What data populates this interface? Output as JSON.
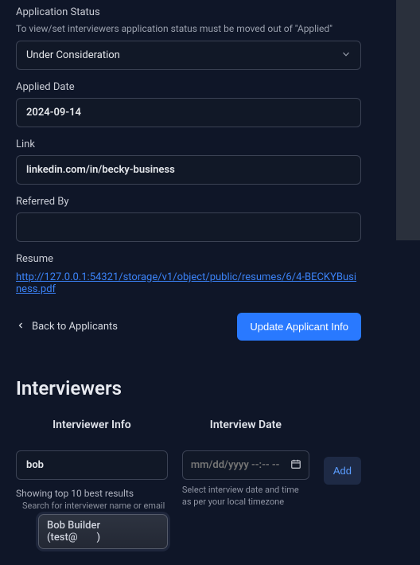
{
  "applicationStatus": {
    "label": "Application Status",
    "helper": "To view/set interviewers application status must be moved out of \"Applied\"",
    "value": "Under Consideration"
  },
  "appliedDate": {
    "label": "Applied Date",
    "value": "2024-09-14"
  },
  "link": {
    "label": "Link",
    "value": "linkedin.com/in/becky-business"
  },
  "referredBy": {
    "label": "Referred By",
    "value": ""
  },
  "resume": {
    "label": "Resume",
    "url": "http://127.0.0.1:54321/storage/v1/object/public/resumes/6/4-BECKYBusiness.pdf"
  },
  "actions": {
    "back": "Back to Applicants",
    "update": "Update Applicant Info"
  },
  "interviewers": {
    "title": "Interviewers",
    "infoHeader": "Interviewer Info",
    "dateHeader": "Interview Date",
    "searchValue": "bob",
    "showingText": "Showing top 10 best results",
    "searchHint": "Search for interviewer name or email",
    "suggestion": "Bob Builder (test@",
    "datePlaceholder": "mm/dd/yyyy --:-- --",
    "tzHint": "Select interview date and time as per your local timezone",
    "addLabel": "Add"
  }
}
